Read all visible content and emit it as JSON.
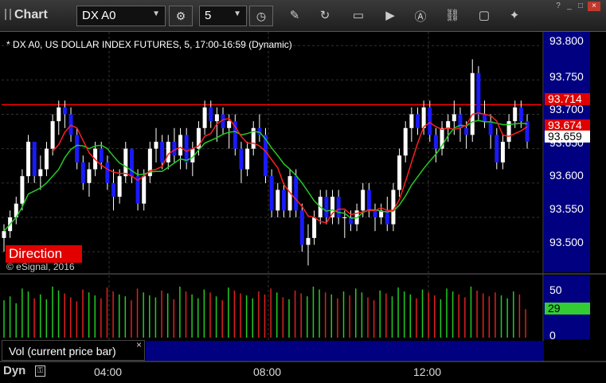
{
  "toolbar": {
    "title": "Chart",
    "symbol": "DX A0",
    "interval": "5",
    "window_controls": [
      "?",
      "_",
      "□",
      "×"
    ]
  },
  "chart": {
    "description": "* DX A0, US DOLLAR INDEX FUTURES, 5, 17:00-16:59 (Dynamic)",
    "direction_label": "Direction",
    "copyright": "© eSignal, 2016",
    "price_ticks": [
      "93.800",
      "93.750",
      "93.700",
      "93.650",
      "93.600",
      "93.550",
      "93.500"
    ],
    "price_tags": [
      {
        "text": "93.714",
        "bg": "#e00000",
        "color": "#ffffff"
      },
      {
        "text": "93.674",
        "bg": "#e00000",
        "color": "#ffffff"
      },
      {
        "text": "93.659",
        "bg": "#ffffff",
        "color": "#000000"
      }
    ],
    "vol_ticks": [
      "50",
      "0"
    ],
    "vol_tag": {
      "text": "29",
      "bg": "#33cc33",
      "color": "#000000"
    },
    "vol_label": "Vol (current price bar)",
    "vol_close": "×",
    "dyn_label": "Dyn",
    "time_labels": [
      "04:00",
      "08:00",
      "12:00"
    ]
  },
  "colors": {
    "up_candle": "#ffffff",
    "down_candle": "#1a1aff",
    "ma_fast": "#ff2020",
    "ma_slow": "#22cc22",
    "axis_bg": "#000080",
    "horizontal_line": "#ff0000"
  },
  "chart_data": {
    "type": "candlestick",
    "y_range": [
      93.47,
      93.82
    ],
    "horizontal_line": 93.714,
    "candles": [
      [
        93.52,
        93.54,
        93.5,
        93.53
      ],
      [
        93.53,
        93.56,
        93.52,
        93.55
      ],
      [
        93.55,
        93.58,
        93.54,
        93.57
      ],
      [
        93.57,
        93.62,
        93.56,
        93.61
      ],
      [
        93.61,
        93.67,
        93.6,
        93.66
      ],
      [
        93.66,
        93.65,
        93.6,
        93.61
      ],
      [
        93.61,
        93.64,
        93.59,
        93.62
      ],
      [
        93.62,
        93.66,
        93.61,
        93.65
      ],
      [
        93.65,
        93.7,
        93.64,
        93.69
      ],
      [
        93.69,
        93.72,
        93.67,
        93.71
      ],
      [
        93.71,
        93.72,
        93.68,
        93.7
      ],
      [
        93.7,
        93.71,
        93.66,
        93.67
      ],
      [
        93.67,
        93.68,
        93.62,
        93.63
      ],
      [
        93.63,
        93.64,
        93.59,
        93.6
      ],
      [
        93.6,
        93.63,
        93.58,
        93.62
      ],
      [
        93.62,
        93.66,
        93.61,
        93.65
      ],
      [
        93.65,
        93.66,
        93.62,
        93.63
      ],
      [
        93.63,
        93.64,
        93.59,
        93.6
      ],
      [
        93.6,
        93.62,
        93.56,
        93.58
      ],
      [
        93.58,
        93.62,
        93.57,
        93.61
      ],
      [
        93.61,
        93.66,
        93.6,
        93.65
      ],
      [
        93.65,
        93.65,
        93.6,
        93.61
      ],
      [
        93.61,
        93.62,
        93.56,
        93.57
      ],
      [
        93.57,
        93.62,
        93.56,
        93.61
      ],
      [
        93.61,
        93.66,
        93.6,
        93.65
      ],
      [
        93.65,
        93.68,
        93.63,
        93.66
      ],
      [
        93.66,
        93.67,
        93.62,
        93.63
      ],
      [
        93.63,
        93.67,
        93.62,
        93.66
      ],
      [
        93.66,
        93.68,
        93.63,
        93.64
      ],
      [
        93.64,
        93.68,
        93.62,
        93.67
      ],
      [
        93.67,
        93.68,
        93.62,
        93.63
      ],
      [
        93.63,
        93.66,
        93.61,
        93.65
      ],
      [
        93.65,
        93.69,
        93.64,
        93.68
      ],
      [
        93.68,
        93.72,
        93.67,
        93.71
      ],
      [
        93.71,
        93.72,
        93.68,
        93.69
      ],
      [
        93.69,
        93.71,
        93.66,
        93.7
      ],
      [
        93.7,
        93.71,
        93.67,
        93.68
      ],
      [
        93.68,
        93.7,
        93.65,
        93.69
      ],
      [
        93.69,
        93.7,
        93.64,
        93.65
      ],
      [
        93.65,
        93.66,
        93.6,
        93.62
      ],
      [
        93.62,
        93.66,
        93.61,
        93.65
      ],
      [
        93.65,
        93.69,
        93.64,
        93.68
      ],
      [
        93.68,
        93.7,
        93.66,
        93.67
      ],
      [
        93.67,
        93.68,
        93.6,
        93.61
      ],
      [
        93.61,
        93.62,
        93.55,
        93.56
      ],
      [
        93.56,
        93.6,
        93.55,
        93.59
      ],
      [
        93.59,
        93.6,
        93.55,
        93.56
      ],
      [
        93.56,
        93.62,
        93.55,
        93.61
      ],
      [
        93.61,
        93.62,
        93.55,
        93.56
      ],
      [
        93.56,
        93.57,
        93.5,
        93.51
      ],
      [
        93.51,
        93.54,
        93.48,
        93.52
      ],
      [
        93.52,
        93.56,
        93.51,
        93.55
      ],
      [
        93.55,
        93.59,
        93.54,
        93.58
      ],
      [
        93.58,
        93.59,
        93.54,
        93.55
      ],
      [
        93.55,
        93.59,
        93.54,
        93.58
      ],
      [
        93.58,
        93.59,
        93.54,
        93.55
      ],
      [
        93.55,
        93.56,
        93.52,
        93.55
      ],
      [
        93.55,
        93.56,
        93.53,
        93.54
      ],
      [
        93.54,
        93.57,
        93.53,
        93.56
      ],
      [
        93.56,
        93.6,
        93.55,
        93.59
      ],
      [
        93.59,
        93.6,
        93.55,
        93.56
      ],
      [
        93.56,
        93.57,
        93.53,
        93.55
      ],
      [
        93.55,
        93.57,
        93.54,
        93.56
      ],
      [
        93.56,
        93.58,
        93.53,
        93.54
      ],
      [
        93.54,
        93.6,
        93.53,
        93.59
      ],
      [
        93.59,
        93.65,
        93.58,
        93.64
      ],
      [
        93.64,
        93.69,
        93.63,
        93.68
      ],
      [
        93.68,
        93.71,
        93.66,
        93.7
      ],
      [
        93.7,
        93.71,
        93.67,
        93.68
      ],
      [
        93.68,
        93.72,
        93.67,
        93.71
      ],
      [
        93.71,
        93.72,
        93.66,
        93.67
      ],
      [
        93.67,
        93.68,
        93.63,
        93.65
      ],
      [
        93.65,
        93.69,
        93.64,
        93.68
      ],
      [
        93.68,
        93.7,
        93.66,
        93.69
      ],
      [
        93.69,
        93.72,
        93.67,
        93.7
      ],
      [
        93.7,
        93.71,
        93.66,
        93.68
      ],
      [
        93.68,
        93.69,
        93.65,
        93.67
      ],
      [
        93.67,
        93.78,
        93.66,
        93.76
      ],
      [
        93.76,
        93.77,
        93.69,
        93.7
      ],
      [
        93.7,
        93.72,
        93.68,
        93.69
      ],
      [
        93.69,
        93.7,
        93.65,
        93.67
      ],
      [
        93.67,
        93.68,
        93.62,
        93.63
      ],
      [
        93.63,
        93.67,
        93.62,
        93.66
      ],
      [
        93.66,
        93.7,
        93.65,
        93.69
      ],
      [
        93.69,
        93.72,
        93.68,
        93.71
      ],
      [
        93.71,
        93.72,
        93.68,
        93.69
      ],
      [
        93.69,
        93.7,
        93.65,
        93.66
      ]
    ],
    "volume": [
      38,
      42,
      35,
      50,
      47,
      40,
      44,
      39,
      52,
      48,
      45,
      41,
      37,
      49,
      46,
      43,
      40,
      51,
      47,
      44,
      42,
      38,
      50,
      46,
      43,
      41,
      48,
      45,
      39,
      52,
      47,
      44,
      40,
      49,
      46,
      42,
      38,
      51,
      48,
      45,
      43,
      40,
      47,
      44,
      50,
      46,
      41,
      39,
      48,
      45,
      42,
      52,
      49,
      46,
      44,
      40,
      47,
      43,
      50,
      46,
      41,
      38,
      48,
      45,
      42,
      51,
      47,
      44,
      40,
      49,
      46,
      43,
      39,
      50,
      47,
      44,
      41,
      52,
      48,
      45,
      42,
      46,
      43,
      40,
      47,
      44,
      29
    ],
    "vol_range": [
      0,
      60
    ]
  }
}
